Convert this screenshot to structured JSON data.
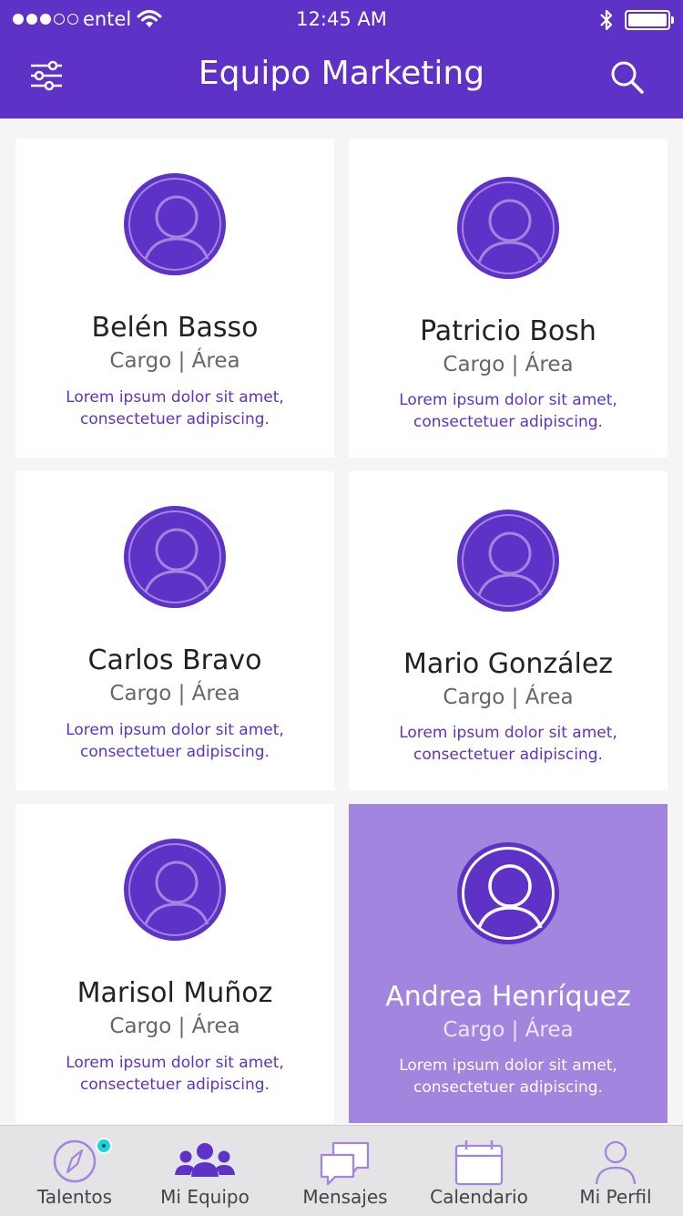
{
  "status_bar": {
    "carrier": "entel",
    "time": "12:45 AM"
  },
  "header": {
    "title": "Equipo Marketing",
    "left_icon": "filter-sliders-icon",
    "right_icon": "search-icon"
  },
  "colors": {
    "primary": "#5e32c7",
    "highlight_card": "#a185de",
    "badge": "#19d6d6"
  },
  "members": [
    {
      "name": "Belén Basso",
      "role": "Cargo | Área",
      "desc_line1": "Lorem ipsum dolor sit amet,",
      "desc_line2": "consectetuer adipiscing.",
      "selected": false
    },
    {
      "name": "Patricio Bosh",
      "role": "Cargo | Área",
      "desc_line1": "Lorem ipsum dolor sit amet,",
      "desc_line2": "consectetuer adipiscing.",
      "selected": false
    },
    {
      "name": "Carlos Bravo",
      "role": "Cargo | Área",
      "desc_line1": "Lorem ipsum dolor sit amet,",
      "desc_line2": "consectetuer adipiscing.",
      "selected": false
    },
    {
      "name": "Mario González",
      "role": "Cargo | Área",
      "desc_line1": "Lorem ipsum dolor sit amet,",
      "desc_line2": "consectetuer adipiscing.",
      "selected": false
    },
    {
      "name": "Marisol Muñoz",
      "role": "Cargo | Área",
      "desc_line1": "Lorem ipsum dolor sit amet,",
      "desc_line2": "consectetuer adipiscing.",
      "selected": false
    },
    {
      "name": "Andrea Henríquez",
      "role": "Cargo | Área",
      "desc_line1": "Lorem ipsum dolor sit amet,",
      "desc_line2": "consectetuer adipiscing.",
      "selected": true
    }
  ],
  "tabs": [
    {
      "label": "Talentos",
      "icon": "compass-icon",
      "has_badge": true
    },
    {
      "label": "Mi Equipo",
      "icon": "team-icon",
      "active": true
    },
    {
      "label": "Mensajes",
      "icon": "chat-bubbles-icon"
    },
    {
      "label": "Calendario",
      "icon": "calendar-icon"
    },
    {
      "label": "Mi Perfil",
      "icon": "user-icon"
    }
  ]
}
